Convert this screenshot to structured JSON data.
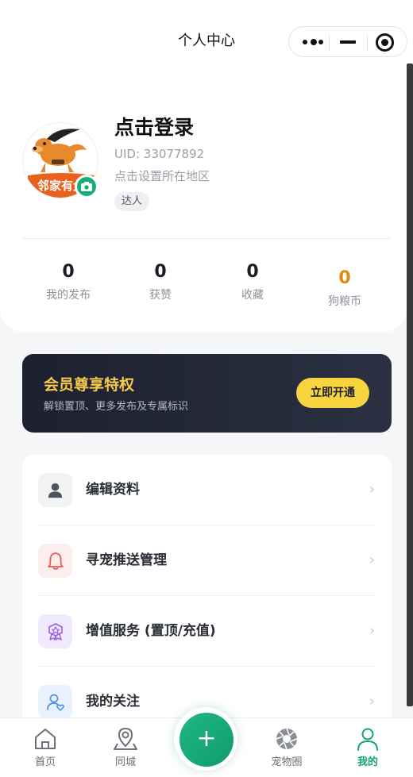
{
  "navbar": {
    "title": "个人中心",
    "capsule_icons": [
      "more-icon",
      "minimize-icon",
      "close-icon"
    ]
  },
  "profile": {
    "login_text": "点击登录",
    "uid": "UID: 33077892",
    "region": "点击设置所在地区",
    "tag": "达人",
    "avatar_logo_text": "邻家有犬",
    "stats": [
      {
        "value": "0",
        "label": "我的发布"
      },
      {
        "value": "0",
        "label": "获赞"
      },
      {
        "value": "0",
        "label": "收藏"
      },
      {
        "value": "0",
        "label": "狗粮币"
      }
    ]
  },
  "vip": {
    "title": "会员尊享特权",
    "subtitle": "解锁置顶、更多发布及专属标识",
    "button": "立即开通"
  },
  "menu": [
    {
      "label": "编辑资料",
      "icon": "user-icon",
      "chevron": "›"
    },
    {
      "label": "寻宠推送管理",
      "icon": "bell-icon",
      "chevron": "›"
    },
    {
      "label": "增值服务 (置顶/充值)",
      "icon": "badge-icon",
      "chevron": "›"
    },
    {
      "label": "我的关注",
      "icon": "follow-icon",
      "chevron": "›"
    }
  ],
  "tabbar": {
    "items": [
      {
        "label": "首页",
        "icon": "home-icon"
      },
      {
        "label": "同城",
        "icon": "location-icon"
      },
      {
        "label": "宠物圈",
        "icon": "aperture-icon"
      },
      {
        "label": "我的",
        "icon": "profile-icon"
      }
    ],
    "fab": "+"
  },
  "colors": {
    "accent": "#13a573",
    "vip_gold": "#f7c948",
    "coin_orange": "#e08a10"
  }
}
